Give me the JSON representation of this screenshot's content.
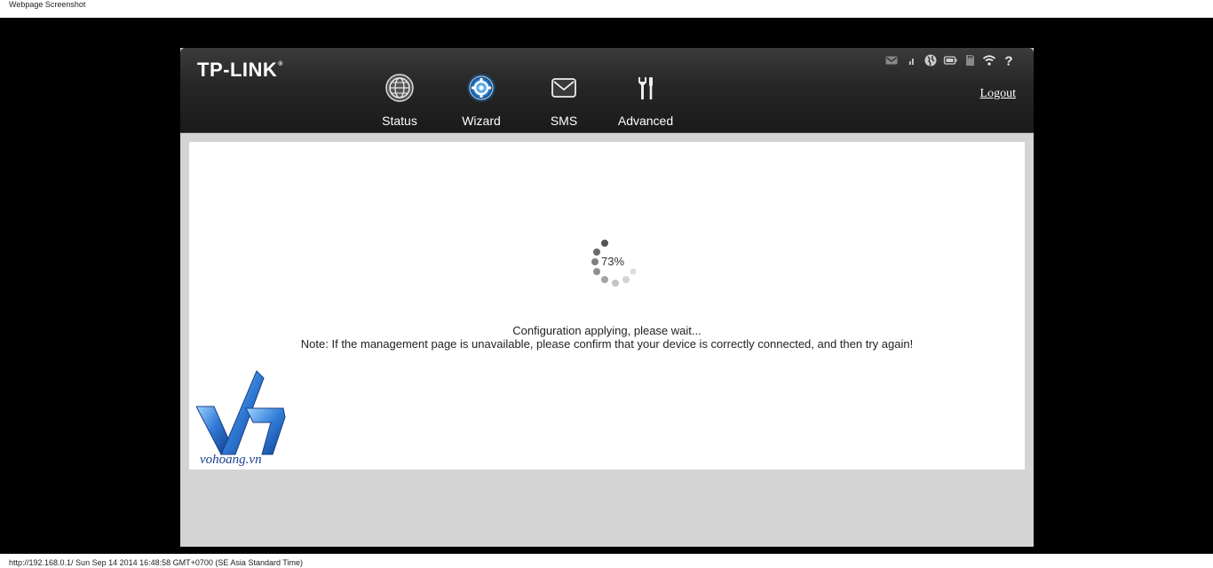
{
  "capture": {
    "title": "Webpage Screenshot",
    "footer": "http://192.168.0.1/ Sun Sep 14 2014 16:48:58 GMT+0700 (SE Asia Standard Time)"
  },
  "header": {
    "brand": "TP-LINK",
    "brand_mark": "®",
    "logout_label": "Logout",
    "nav": [
      {
        "label": "Status",
        "icon": "globe-icon"
      },
      {
        "label": "Wizard",
        "icon": "wizard-icon",
        "active": true
      },
      {
        "label": "SMS",
        "icon": "envelope-icon"
      },
      {
        "label": "Advanced",
        "icon": "tools-icon"
      }
    ],
    "status_icons": [
      "sms-status-icon",
      "signal-icon",
      "internet-icon",
      "battery-icon",
      "sd-card-icon",
      "wifi-icon",
      "help-icon"
    ]
  },
  "progress": {
    "percent_text": "73%",
    "value": 73
  },
  "messages": {
    "line1": "Configuration applying, please wait...",
    "line2": "Note: If the management page is unavailable, please confirm that your device is correctly connected, and then try again!"
  },
  "watermark": {
    "text": "vohoang.vn"
  },
  "colors": {
    "header_bg": "#262626",
    "content_bg": "#ffffff",
    "frame_bg": "#d4d4d4",
    "active_glow": "#3f8fd8"
  }
}
